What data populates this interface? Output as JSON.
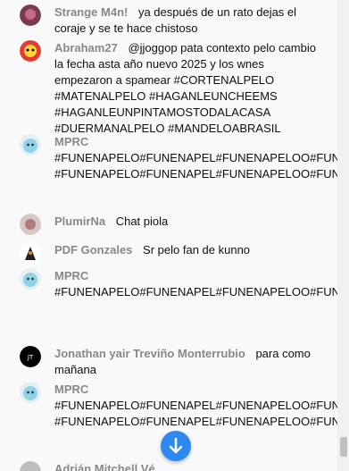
{
  "messages": [
    {
      "author": "Strange M4n!",
      "text": "ya después de un rato dejas el coraje y se te hace chistoso"
    },
    {
      "author": "Abraham27",
      "text": "@jjoggop pata contexto pelo cambio la fecha asta año nuevo 2025 y los wnes empezaron a spamear #CORTENALPELO #MATENALPELO #HAGANLEUNCHEEMS #HAGANLEUNPINTAMOSTODALACASA #DUERMANALPELO #MANDELOABRASIL"
    },
    {
      "author": "MPRC",
      "text": "#FUNENAPELO#FUNENAPEL#FUNENAPELOO#FUNENAPELO #FUNENAPELO#FUNENAPEL#FUNENAPELOO#FUNENAPELO"
    },
    {
      "author": "PlumirNa",
      "text": "Chat piola"
    },
    {
      "author": "PDF Gonzales",
      "text": "Sr pelo fan de kunno"
    },
    {
      "author": "MPRC",
      "text": "#FUNENAPELO#FUNENAPEL#FUNENAPELOO#FUNENAPELO"
    },
    {
      "author": "Jonathan yair Treviño Monterrubio",
      "text": "para como mañana"
    },
    {
      "author": "MPRC",
      "text": "#FUNENAPELO#FUNENAPEL#FUNENAPELOO#FUNENAPELO #FUNENAPELO#FUNENAPEL#FUNENAPELOO#FUNENAPELO"
    },
    {
      "author": "Adrián Mitchell Vé ...",
      "text": ""
    }
  ]
}
